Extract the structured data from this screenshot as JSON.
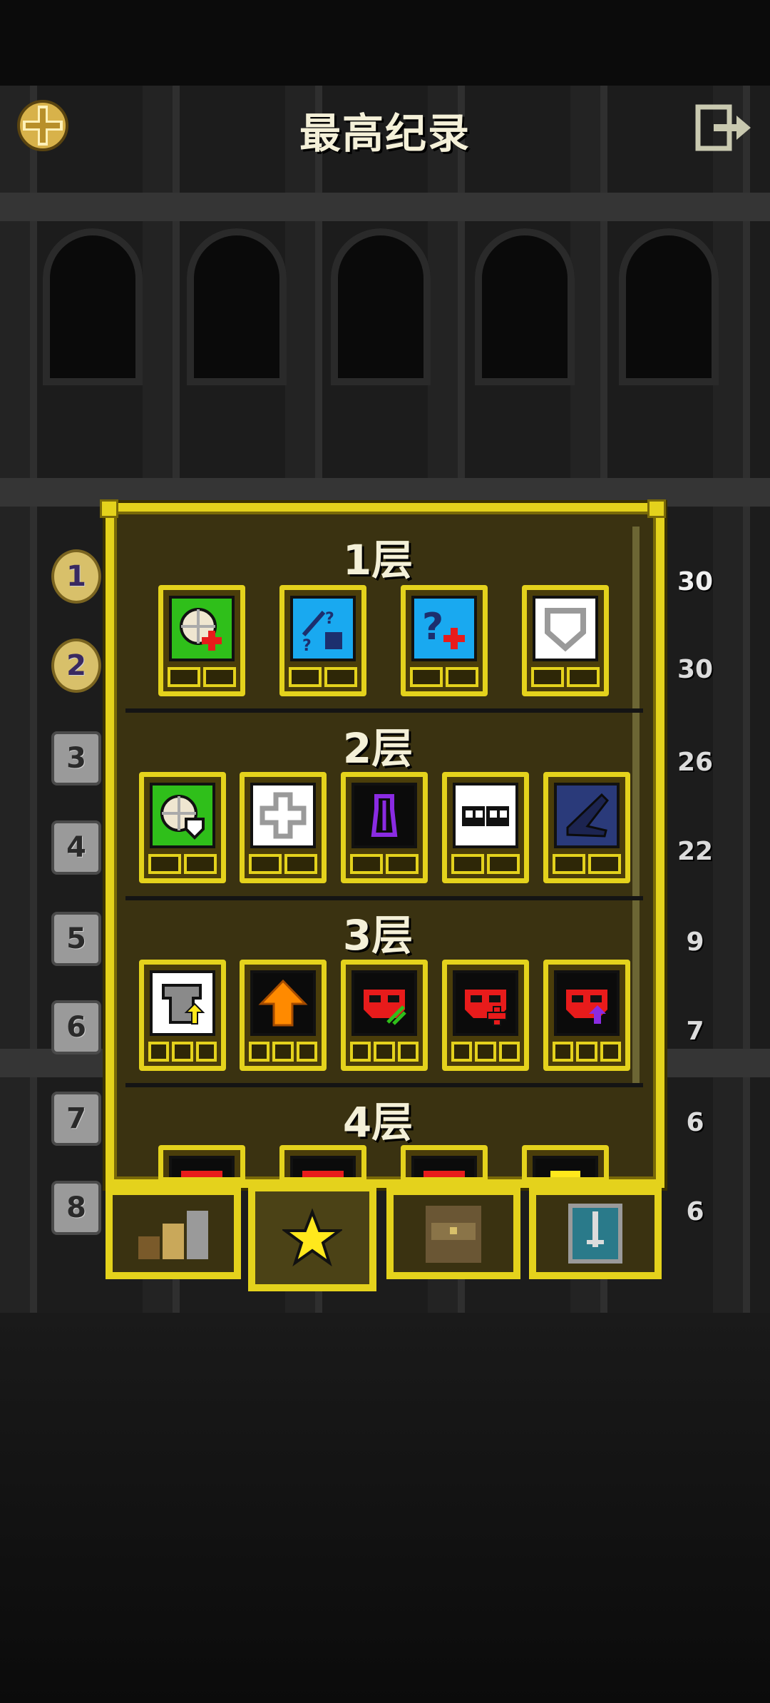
{
  "header": {
    "title": "最高纪录"
  },
  "depths": [
    {
      "label": "1",
      "value": "30"
    },
    {
      "label": "2",
      "value": "30"
    },
    {
      "label": "3",
      "value": "26"
    },
    {
      "label": "4",
      "value": "22"
    },
    {
      "label": "5",
      "value": "9"
    },
    {
      "label": "6",
      "value": "7"
    },
    {
      "label": "7",
      "value": "6"
    },
    {
      "label": "8",
      "value": "6"
    }
  ],
  "floors": [
    {
      "title": "1层",
      "badges": [
        "health-plus-badge-icon",
        "unknown-equipment-badge-icon",
        "unknown-item-plus-badge-icon",
        "armor-shield-badge-icon"
      ]
    },
    {
      "title": "2层",
      "badges": [
        "health-shield-badge-icon",
        "cross-badge-icon",
        "purple-potion-badge-icon",
        "skulls-badge-icon",
        "blue-boot-badge-icon"
      ]
    },
    {
      "title": "3层",
      "badges": [
        "armor-upgrade-badge-icon",
        "orange-arrow-badge-icon",
        "red-mask-badge-icon",
        "red-mask-plus-badge-icon",
        "red-mask-purple-badge-icon"
      ]
    },
    {
      "title": "4层",
      "badges": [
        "red-badge-icon",
        "red-badge-icon",
        "red-badge-icon",
        "yellow-badge-icon"
      ]
    }
  ],
  "tabs": [
    "rankings-tab",
    "badges-tab",
    "journal-tab",
    "items-tab"
  ],
  "colors": {
    "gold": "#e4d21c",
    "panel": "#3a3211",
    "green": "#2fbf1a",
    "blue": "#19a9f0",
    "red": "#e81b1b",
    "orange": "#ff8a00",
    "purple": "#8a2be2"
  }
}
